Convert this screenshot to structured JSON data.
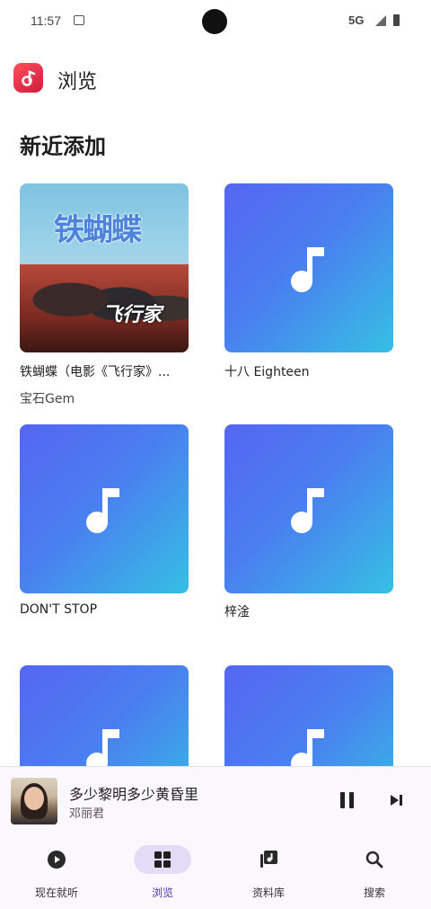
{
  "status_bar": {
    "time": "11:57",
    "network": "5G"
  },
  "header": {
    "title": "浏览"
  },
  "section": {
    "title": "新近添加"
  },
  "albums": [
    {
      "title": "铁蝴蝶（电影《飞行家》...",
      "artist": "宝石Gem",
      "cover_text": "铁蝴蝶",
      "cover_logo": "飞行家"
    },
    {
      "title": "十八 Eighteen",
      "artist": ""
    },
    {
      "title": "DON'T STOP",
      "artist": ""
    },
    {
      "title": "梓淦",
      "artist": ""
    },
    {
      "title": "",
      "artist": ""
    },
    {
      "title": "",
      "artist": ""
    }
  ],
  "now_playing": {
    "title": "多少黎明多少黄昏里",
    "artist": "邓丽君"
  },
  "bottom_nav": [
    {
      "label": "现在就听",
      "icon": "play-circle-icon",
      "active": false
    },
    {
      "label": "浏览",
      "icon": "grid-icon",
      "active": true
    },
    {
      "label": "资料库",
      "icon": "library-icon",
      "active": false
    },
    {
      "label": "搜索",
      "icon": "search-icon",
      "active": false
    }
  ],
  "colors": {
    "art_gradient_start": "#5566f2",
    "art_gradient_end": "#35c0e3",
    "nav_active_bg": "#e3dcf6",
    "logo_red": "#e0283f"
  }
}
